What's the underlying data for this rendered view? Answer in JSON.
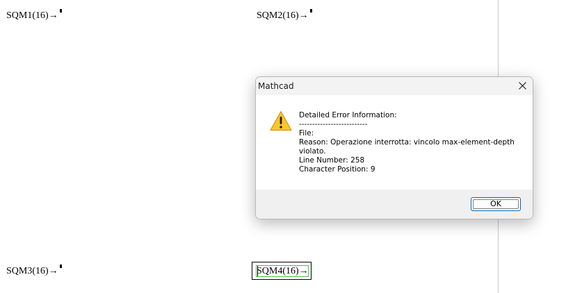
{
  "worksheet": {
    "regions": [
      {
        "label": "SQM1(16)→"
      },
      {
        "label": "SQM2(16)→"
      },
      {
        "label": "SQM3(16)→"
      },
      {
        "label": "SQM4(16)→"
      }
    ]
  },
  "dialog": {
    "title": "Mathcad",
    "icon": "warning-icon",
    "lines": {
      "heading": "Detailed Error Information:",
      "separator": "--------------------------",
      "file": "File:",
      "reason": "Reason: Operazione interrotta: vincolo max-element-depth violato.",
      "line_number": "Line Number: 258",
      "char_position": "Character Position: 9"
    },
    "ok_label": "OK"
  },
  "colors": {
    "warning_fill": "#FFC627",
    "accent": "#0067C0",
    "edit_box": "#3CC83C"
  }
}
